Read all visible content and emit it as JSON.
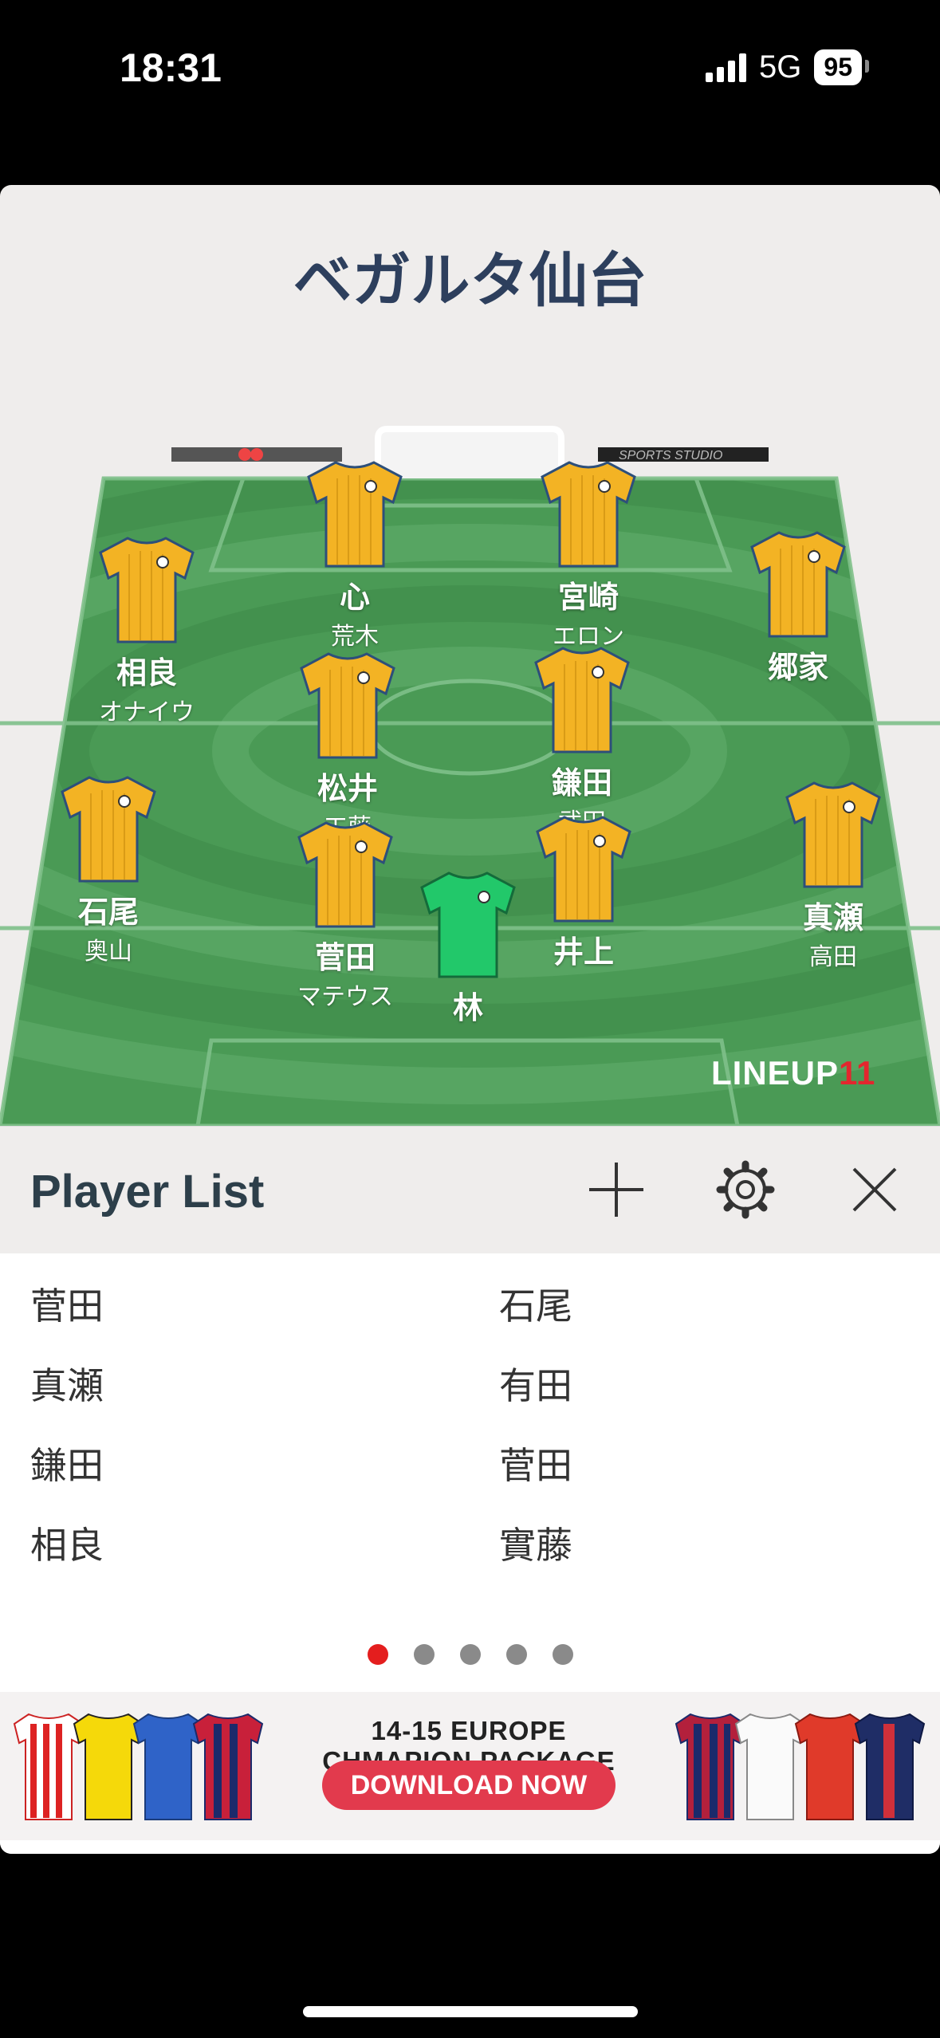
{
  "status": {
    "time": "18:31",
    "network": "5G",
    "battery": "95"
  },
  "team": {
    "name": "ベガルタ仙台"
  },
  "pitch": {
    "board_left_text": "",
    "board_right_text": "SPORTS STUDIO",
    "brand_text": "LINEUP",
    "brand_number": "11"
  },
  "players": [
    {
      "name": "心",
      "sub": "荒木"
    },
    {
      "name": "宮崎",
      "sub": "エロン"
    },
    {
      "name": "相良",
      "sub": "オナイウ"
    },
    {
      "name": "郷家",
      "sub": ""
    },
    {
      "name": "松井",
      "sub": "工藤"
    },
    {
      "name": "鎌田",
      "sub": "武田"
    },
    {
      "name": "石尾",
      "sub": "奥山"
    },
    {
      "name": "真瀬",
      "sub": "高田"
    },
    {
      "name": "菅田",
      "sub": "マテウス"
    },
    {
      "name": "井上",
      "sub": ""
    },
    {
      "name": "林",
      "sub": ""
    }
  ],
  "player_list": {
    "title": "Player List",
    "items": [
      "菅田",
      "石尾",
      "真瀬",
      "有田",
      "鎌田",
      "菅田",
      "相良",
      "實藤"
    ]
  },
  "icons": [
    "add-icon",
    "gear-icon",
    "close-icon"
  ],
  "colors": {
    "home_shirt": "#f3b324",
    "keeper_shirt": "#22c86a",
    "pitch": "#4a9a55",
    "accent": "#e41e1e"
  },
  "pagination": {
    "count": 5,
    "active": 1
  },
  "ad": {
    "headline": "14-15 EUROPE CHMAPION PACKAGE",
    "button": "DOWNLOAD NOW"
  }
}
